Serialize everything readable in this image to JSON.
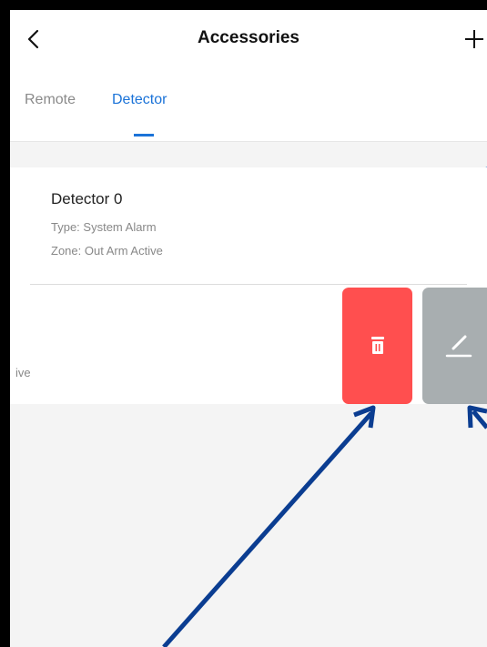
{
  "header": {
    "title": "Accessories",
    "back_icon": "chevron-left-icon",
    "add_icon": "plus-icon"
  },
  "tabs": [
    {
      "label": "Remote",
      "active": false
    },
    {
      "label": "Detector",
      "active": true
    }
  ],
  "detectors": [
    {
      "name": "Detector 0",
      "type": "Type: System Alarm",
      "zone": "Zone: Out Arm Active"
    },
    {
      "partial_text": "ive"
    }
  ],
  "actions": {
    "delete_icon": "trash-icon",
    "edit_icon": "pencil-icon",
    "delete_color": "#ff4f4f",
    "edit_color": "#a8aeb0"
  },
  "colors": {
    "accent": "#1b73d8",
    "annotation_arrow": "#0b3d91"
  }
}
